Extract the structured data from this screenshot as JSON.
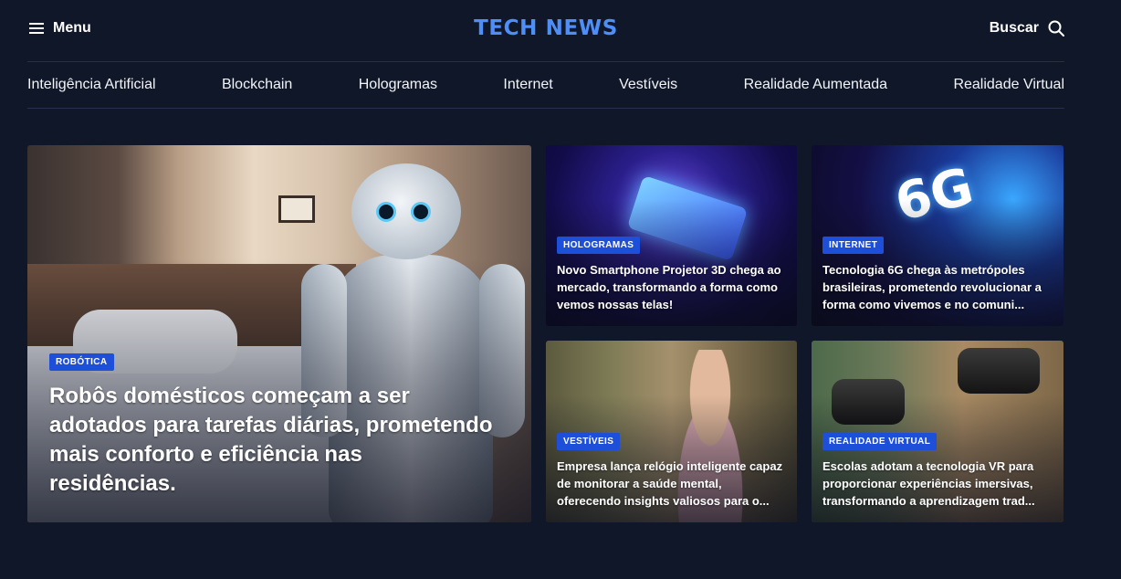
{
  "header": {
    "menu_label": "Menu",
    "logo": "TECH NEWS",
    "search_label": "Buscar"
  },
  "nav": {
    "items": [
      "Inteligência Artificial",
      "Blockchain",
      "Hologramas",
      "Internet",
      "Vestíveis",
      "Realidade Aumentada",
      "Realidade Virtual"
    ]
  },
  "featured": {
    "main": {
      "badge": "ROBÓTICA",
      "title": "Robôs domésticos começam a ser adotados para tarefas diárias, prometendo mais conforto e eficiência nas residências."
    },
    "cards": [
      {
        "badge": "HOLOGRAMAS",
        "title": "Novo Smartphone Projetor 3D chega ao mercado, transformando a forma como vemos nossas telas!"
      },
      {
        "badge": "INTERNET",
        "title": "Tecnologia 6G chega às metrópoles brasileiras, prometendo revolucionar a forma como vivemos e no comuni..."
      },
      {
        "badge": "VESTÍVEIS",
        "title": "Empresa lança relógio inteligente capaz de monitorar a saúde mental, oferecendo insights valiosos para o..."
      },
      {
        "badge": "REALIDADE VIRTUAL",
        "title": "Escolas adotam a tecnologia VR para proporcionar experiências imersivas, transformando a aprendizagem trad..."
      }
    ],
    "image_text": {
      "six_g": "6G"
    }
  },
  "colors": {
    "background": "#0f1729",
    "logo": "#4d8ff7",
    "badge": "#1e4fd8",
    "divider": "#26304a"
  },
  "icons": {
    "menu": "hamburger-icon",
    "search": "search-icon"
  }
}
